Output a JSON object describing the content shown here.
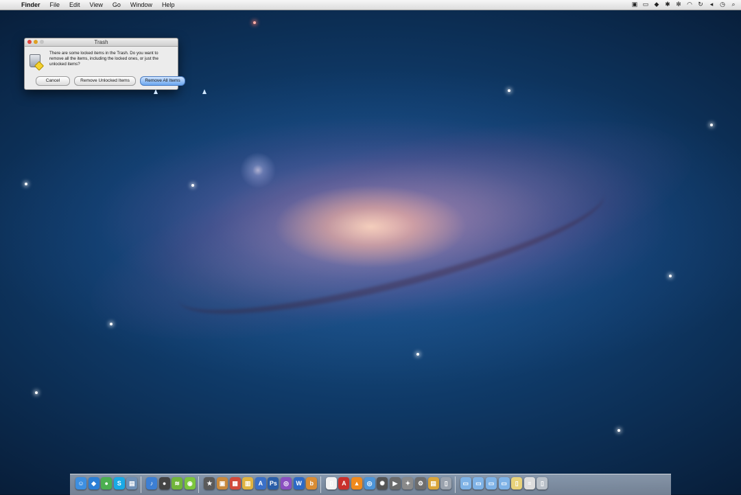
{
  "menubar": {
    "apple_glyph": "",
    "app_name": "Finder",
    "items": [
      "File",
      "Edit",
      "View",
      "Go",
      "Window",
      "Help"
    ],
    "status_icons": [
      "screen-record-icon",
      "airplay-icon",
      "dropbox-icon",
      "settings-icon",
      "bluetooth-icon",
      "wifi-icon",
      "sync-icon",
      "volume-icon",
      "clock-icon",
      "search-icon"
    ]
  },
  "dialog": {
    "title": "Trash",
    "message": "There are some locked items in the Trash. Do you want to remove all the items, including the locked ones, or just the unlocked items?",
    "buttons": {
      "cancel": "Cancel",
      "remove_unlocked": "Remove Unlocked Items",
      "remove_all": "Remove All Items"
    },
    "default_button_color": "#6aa6ef"
  },
  "dock": {
    "apps": [
      {
        "name": "finder-icon",
        "color": "#3d8fe0",
        "glyph": "☺"
      },
      {
        "name": "dropbox-icon",
        "color": "#2b7fd6",
        "glyph": "◆"
      },
      {
        "name": "chrome-icon",
        "color": "#4caf50",
        "glyph": "●"
      },
      {
        "name": "skype-icon",
        "color": "#19a9e6",
        "glyph": "S"
      },
      {
        "name": "preview-icon",
        "color": "#6e8fb5",
        "glyph": "▤"
      },
      {
        "name": "itunes-icon",
        "color": "#3c7fd4",
        "glyph": "♪"
      },
      {
        "name": "record-icon",
        "color": "#444444",
        "glyph": "●"
      },
      {
        "name": "spotify-icon",
        "color": "#71b53b",
        "glyph": "≋"
      },
      {
        "name": "messages-icon",
        "color": "#7cc63d",
        "glyph": "◉"
      },
      {
        "name": "imovie-icon",
        "color": "#5a5a5a",
        "glyph": "★"
      },
      {
        "name": "iphoto-icon",
        "color": "#c8893c",
        "glyph": "▣"
      },
      {
        "name": "photo-booth-icon",
        "color": "#d14a3b",
        "glyph": "▦"
      },
      {
        "name": "notes-icon",
        "color": "#e0b340",
        "glyph": "▥"
      },
      {
        "name": "app-store-icon",
        "color": "#3a70c8",
        "glyph": "A"
      },
      {
        "name": "photoshop-icon",
        "color": "#2a5ea8",
        "glyph": "Ps"
      },
      {
        "name": "dashboard-icon",
        "color": "#8a4fc0",
        "glyph": "◎"
      },
      {
        "name": "word-icon",
        "color": "#2d69c6",
        "glyph": "W"
      },
      {
        "name": "mirror-icon",
        "color": "#d98c34",
        "glyph": "b"
      },
      {
        "name": "pages-icon",
        "color": "#f2f2f2",
        "glyph": "▯"
      },
      {
        "name": "acrobat-icon",
        "color": "#c9302c",
        "glyph": "A"
      },
      {
        "name": "vlc-icon",
        "color": "#f08a1c",
        "glyph": "▲"
      },
      {
        "name": "safari-icon",
        "color": "#4d95d8",
        "glyph": "◎"
      },
      {
        "name": "dvd-player-icon",
        "color": "#555555",
        "glyph": "✺"
      },
      {
        "name": "facetime-icon",
        "color": "#6b6b6b",
        "glyph": "▶"
      },
      {
        "name": "automator-icon",
        "color": "#8a8a8a",
        "glyph": "✦"
      },
      {
        "name": "utility-icon",
        "color": "#6e6e6e",
        "glyph": "⚙"
      },
      {
        "name": "zip-icon",
        "color": "#d9a53a",
        "glyph": "▤"
      },
      {
        "name": "trash-full-icon",
        "color": "#9aa2ad",
        "glyph": "▯"
      },
      {
        "name": "applications-folder-icon",
        "color": "#7eb2e6",
        "glyph": "▭"
      },
      {
        "name": "documents-folder-icon",
        "color": "#7eb2e6",
        "glyph": "▭"
      },
      {
        "name": "downloads-folder-icon",
        "color": "#7eb2e6",
        "glyph": "▭"
      },
      {
        "name": "desktop-folder-icon",
        "color": "#7eb2e6",
        "glyph": "▭"
      },
      {
        "name": "archive-icon",
        "color": "#e8d27a",
        "glyph": "▯"
      },
      {
        "name": "list-icon",
        "color": "#dddddd",
        "glyph": "≡"
      },
      {
        "name": "trash-icon",
        "color": "#b9c0c8",
        "glyph": "▯"
      }
    ]
  }
}
